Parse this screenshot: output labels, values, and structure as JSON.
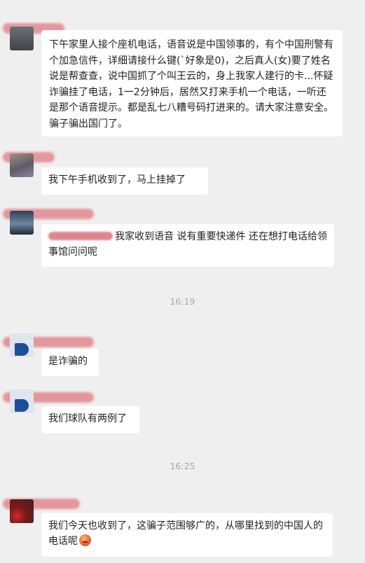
{
  "messages": [
    {
      "id": "m1",
      "text": "下午家里人接个座机电话，语音说是中国领事的，有个中国刑警有个加急信件，详细请接什么键(`好象是0)，之后真人(女)要了姓名说是帮查查，说中国抓了个叫王云的，身上我家人建行的卡...怀疑诈骗挂了电话，1一2分钟后，居然又打来手机一个电话，一听还是那个语音提示。都是乱七八糟号码打进来的。请大家注意安全。骗子骗出国门了。"
    },
    {
      "id": "m2",
      "text": "我下午手机收到了，马上挂掉了"
    },
    {
      "id": "m3",
      "text": "我家收到语音 说有重要快递件 还在想打电话给领事馆问问呢"
    },
    {
      "id": "m4",
      "text": "是诈骗的"
    },
    {
      "id": "m5",
      "text": "我们球队有两例了"
    },
    {
      "id": "m6",
      "text": "我们今天也收到了，这骗子范围够广的，从哪里找到的中国人的电话呢"
    }
  ],
  "timestamps": [
    "16:19",
    "16:25"
  ],
  "icons": {
    "emoji": "angry-face-icon"
  },
  "colors": {
    "background": "#efefef",
    "bubble": "#ffffff",
    "redaction": "#e3878f",
    "time": "#a8a8a8"
  }
}
